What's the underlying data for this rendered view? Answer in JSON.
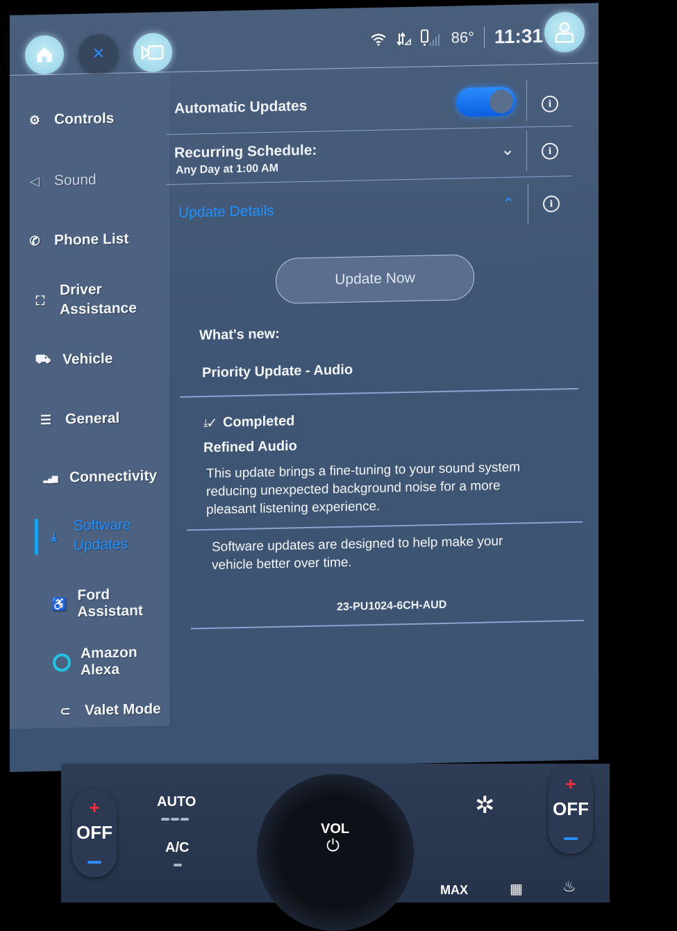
{
  "topbar": {
    "buttons": [
      {
        "name": "home",
        "icon": "home-icon"
      },
      {
        "name": "close",
        "icon": "close-icon",
        "glyph": "✕"
      },
      {
        "name": "camera",
        "icon": "camera-icon"
      }
    ],
    "status": {
      "icons": [
        "wifi-icon",
        "data-transfer-icon",
        "phone-signal-icon"
      ],
      "temperature": "86°",
      "time": "11:31"
    },
    "profile_icon": "profile-icon"
  },
  "sidebar": {
    "items": [
      {
        "label": "Controls",
        "icon": "controls-icon",
        "glyph": "⚙"
      },
      {
        "label": "Sound",
        "icon": "speaker-icon",
        "glyph": "◁"
      },
      {
        "label": "Phone List",
        "icon": "phone-icon",
        "glyph": "✆"
      },
      {
        "label": "Driver Assistance",
        "line1": "Driver",
        "line2": "Assistance",
        "icon": "driver-assist-icon",
        "glyph": "⛶"
      },
      {
        "label": "Vehicle",
        "icon": "vehicle-icon",
        "glyph": "⛟"
      },
      {
        "label": "General",
        "icon": "sliders-icon",
        "glyph": "☰"
      },
      {
        "label": "Connectivity",
        "icon": "signal-bars-icon",
        "glyph": "▂▄▆"
      },
      {
        "label": "Software Updates",
        "line1": "Software",
        "line2": "Updates",
        "icon": "download-icon",
        "glyph": "⤓",
        "active": true
      },
      {
        "label": "Ford Assistant",
        "icon": "assistant-icon",
        "glyph": "♿"
      },
      {
        "label": "Amazon Alexa",
        "icon": "alexa-icon",
        "glyph": "◯"
      },
      {
        "label": "Valet Mode",
        "icon": "valet-icon",
        "glyph": "⊂"
      }
    ]
  },
  "settings": {
    "automatic_updates": {
      "label": "Automatic Updates",
      "enabled": true
    },
    "recurring_schedule": {
      "label": "Recurring Schedule:",
      "value": "Any Day at 1:00 AM",
      "chevron": "⌄"
    },
    "update_details": {
      "label": "Update Details",
      "chevron": "⌃",
      "accent": "#1e90ff"
    },
    "info_glyph": "i"
  },
  "details": {
    "update_now_label": "Update Now",
    "whats_new_label": "What's new:",
    "priority_update": "Priority Update - Audio",
    "status": "Completed",
    "status_icon": "download-complete-icon",
    "feature_title": "Refined Audio",
    "feature_desc": "This update brings a fine-tuning to your sound system reducing unexpected background noise for a more pleasant listening experience.",
    "footer_note": "Software updates are designed to help make your vehicle better over time.",
    "version_code": "23-PU1024-6CH-AUD"
  },
  "climate": {
    "left_temp": {
      "plus": "+",
      "value": "OFF"
    },
    "auto_label": "AUTO",
    "ac_label": "A/C",
    "volume_label": "VOL",
    "power_glyph": "⏻",
    "right_temp": {
      "plus": "+",
      "value": "OFF"
    },
    "max_defrost_label": "MAX",
    "colors": {
      "plus": "#ff2a3a",
      "minus": "#2a8cff"
    }
  }
}
